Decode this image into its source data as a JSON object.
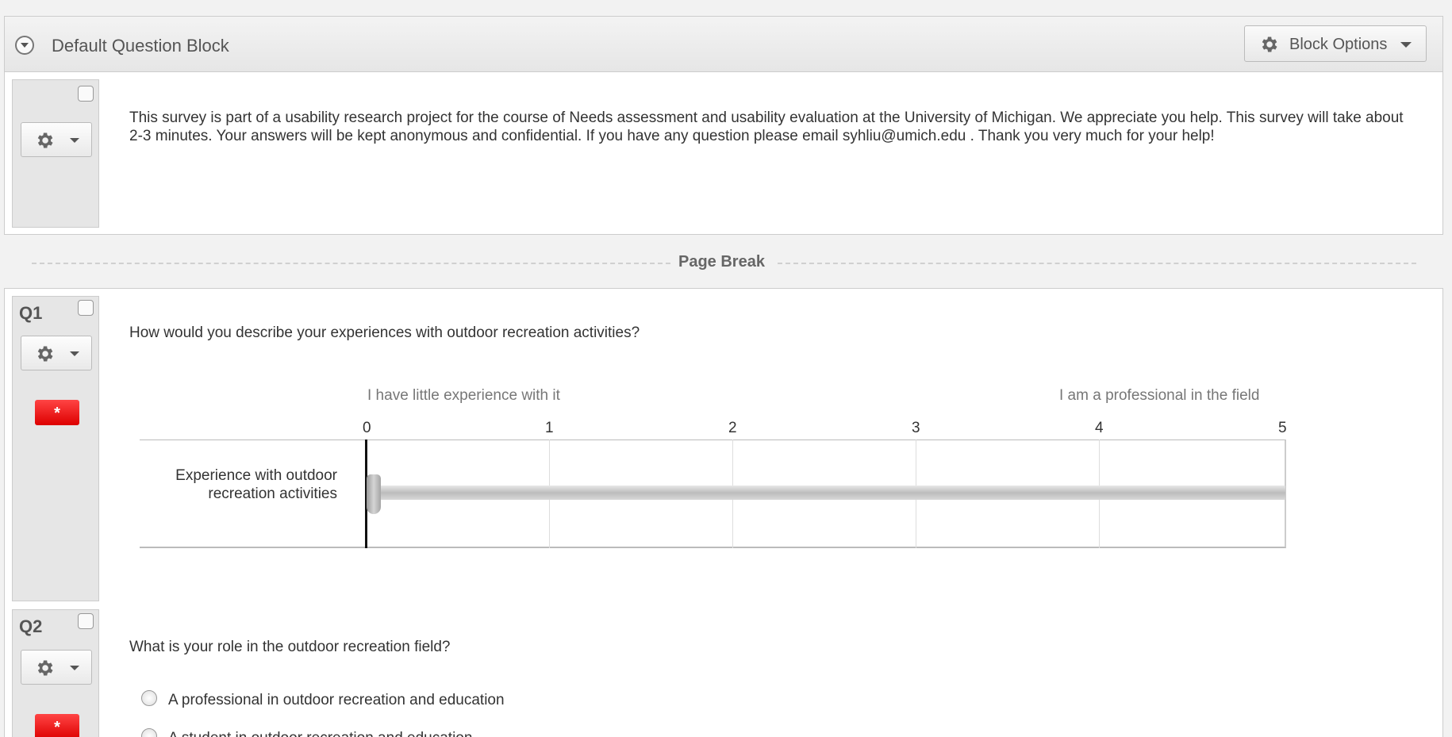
{
  "block": {
    "title": "Default Question Block",
    "options_label": "Block Options"
  },
  "intro": {
    "text": "This survey is part of a usability research project for the course of Needs assessment and usability evaluation at the University of Michigan. We appreciate you help. This survey will take about 2-3 minutes. Your answers will be kept anonymous and confidential. If you have any question please email syhliu@umich.edu . Thank you very much for your help!"
  },
  "page_break_label": "Page Break",
  "q1": {
    "number": "Q1",
    "required_mark": "*",
    "text": "How would you describe your experiences with outdoor recreation activities?",
    "anchor_left": "I have little experience with it",
    "anchor_right": "I am a professional in the field",
    "ticks": [
      "0",
      "1",
      "2",
      "3",
      "4",
      "5"
    ],
    "statement": "Experience with outdoor recreation activities",
    "slider_value": 0,
    "slider_min": 0,
    "slider_max": 5
  },
  "q2": {
    "number": "Q2",
    "required_mark": "*",
    "text": "What is your role in the outdoor recreation field?",
    "choices": [
      "A professional in outdoor recreation and education",
      "A student in outdoor recreation and education"
    ]
  },
  "icons": {
    "gear": "gear-icon",
    "collapse": "chevron-down-circle-icon",
    "caret": "caret-down-icon",
    "required": "asterisk-icon"
  }
}
